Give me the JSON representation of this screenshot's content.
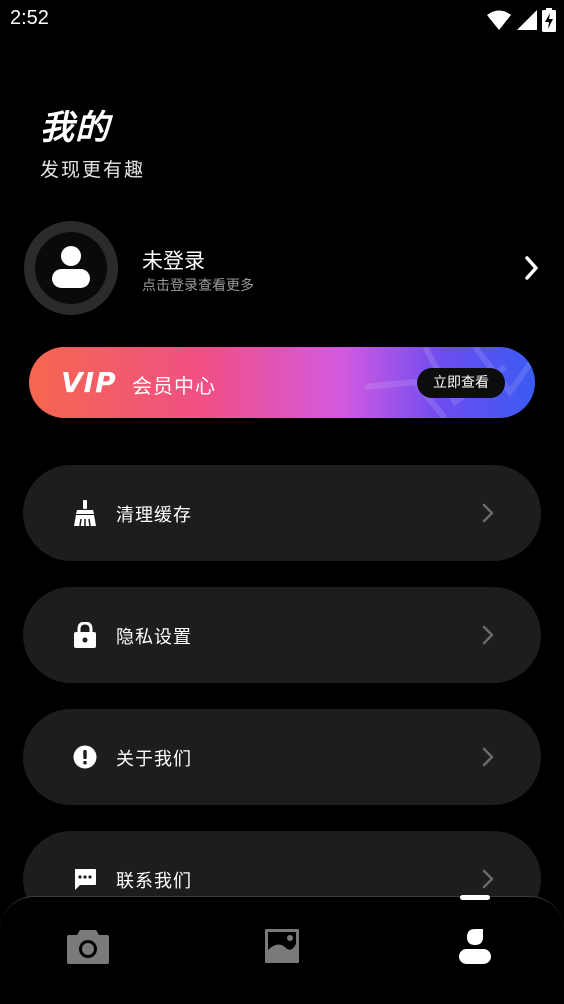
{
  "status_bar": {
    "time": "2:52",
    "icons": [
      "wifi-icon",
      "signal-icon",
      "battery-charging-icon"
    ]
  },
  "header": {
    "title": "我的",
    "subtitle": "发现更有趣"
  },
  "profile": {
    "name": "未登录",
    "description": "点击登录查看更多",
    "avatar_icon": "user-icon"
  },
  "vip": {
    "logo": "VIP",
    "title": "会员中心",
    "button_label": "立即查看",
    "colors": [
      "#f5674f",
      "#f04f86",
      "#d25ae0",
      "#6c4cf0",
      "#3a5bf2"
    ]
  },
  "menu": {
    "items": [
      {
        "label": "清理缓存",
        "icon": "broom-icon"
      },
      {
        "label": "隐私设置",
        "icon": "lock-icon"
      },
      {
        "label": "关于我们",
        "icon": "info-icon"
      },
      {
        "label": "联系我们",
        "icon": "message-icon"
      }
    ]
  },
  "bottom_nav": {
    "items": [
      {
        "icon": "camera-icon",
        "active": false
      },
      {
        "icon": "gallery-icon",
        "active": false
      },
      {
        "icon": "profile-icon",
        "active": true
      }
    ]
  }
}
